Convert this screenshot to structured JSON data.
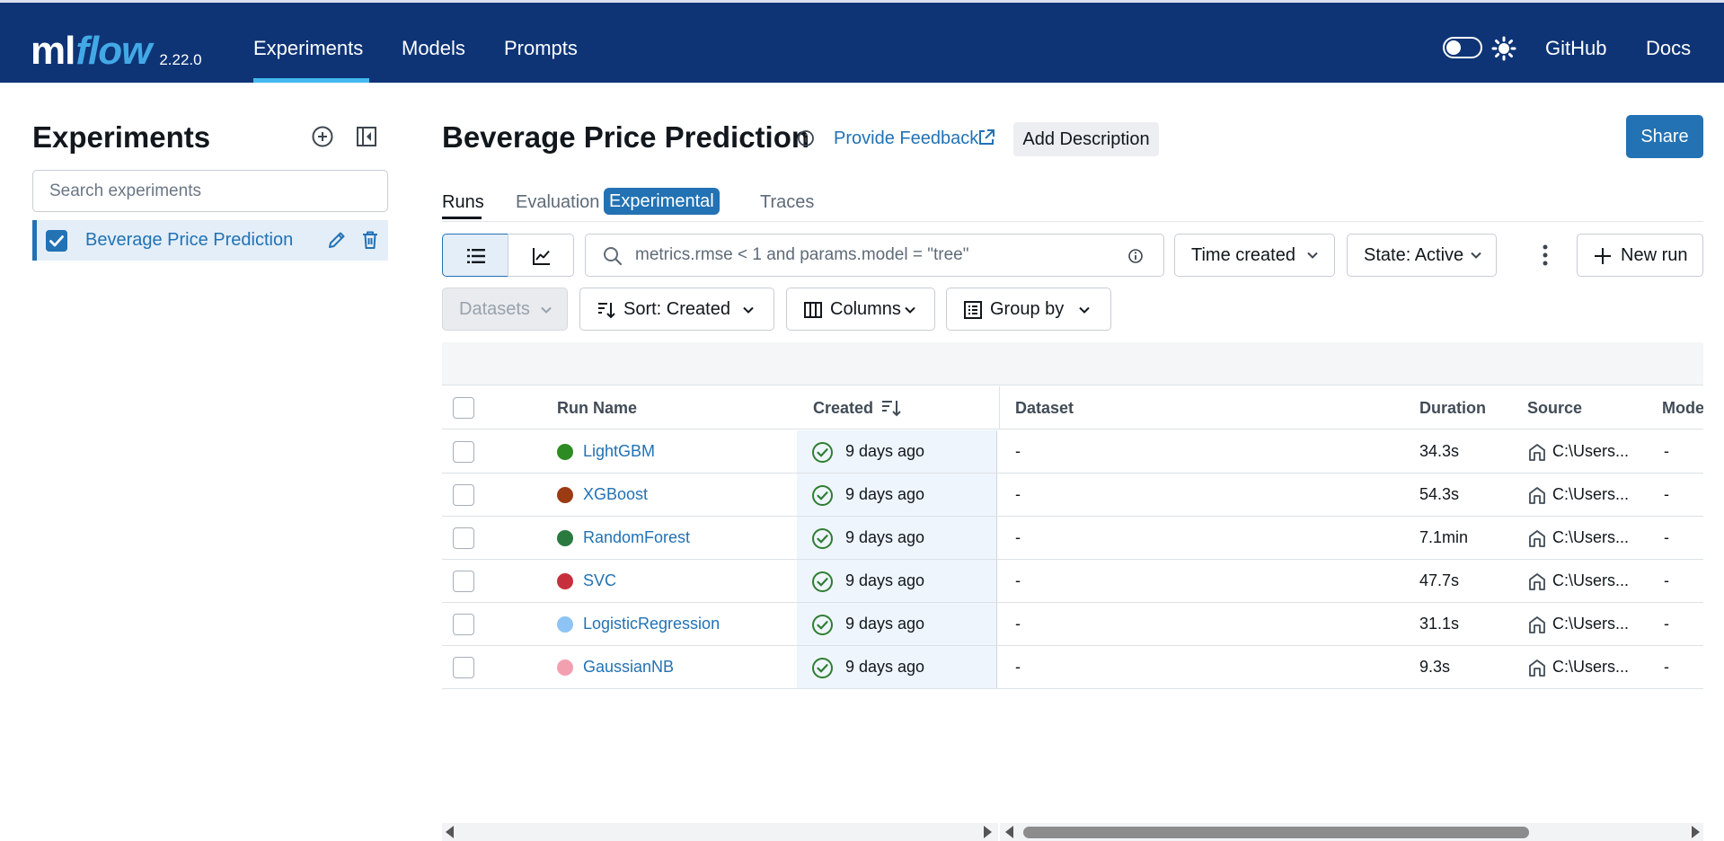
{
  "header": {
    "logo_ml": "ml",
    "logo_flow": "flow",
    "version": "2.22.0",
    "nav": [
      "Experiments",
      "Models",
      "Prompts"
    ],
    "active_nav": "Experiments",
    "right_links": [
      "GitHub",
      "Docs"
    ],
    "theme_toggle_on": false,
    "icons": [
      "toggle-switch",
      "sun-icon"
    ],
    "colors": {
      "bar": "#0e3476",
      "accent": "#43b9ef",
      "flow": "#43a8e6"
    }
  },
  "sidebar": {
    "title": "Experiments",
    "search_placeholder": "Search experiments",
    "icons": [
      "add-circle-icon",
      "collapse-sidebar-icon"
    ],
    "experiments": [
      {
        "label": "Beverage Price Prediction",
        "checked": true,
        "icons": [
          "pencil-icon",
          "trash-icon"
        ]
      }
    ]
  },
  "main": {
    "title": "Beverage Price Prediction",
    "feedback_link": "Provide Feedback",
    "add_description": "Add Description",
    "share": "Share",
    "tabs": [
      {
        "label": "Runs",
        "active": true
      },
      {
        "label": "Evaluation",
        "badge": "Experimental"
      },
      {
        "label": "Traces"
      }
    ],
    "toolbar": {
      "query_placeholder": "metrics.rmse < 1 and params.model = \"tree\"",
      "time_filter": "Time created",
      "state_filter": "State: Active",
      "new_run": "New run",
      "datasets": "Datasets",
      "sort": "Sort: Created",
      "columns": "Columns",
      "group_by": "Group by"
    },
    "table": {
      "headers": [
        "Run Name",
        "Created",
        "Dataset",
        "Duration",
        "Source",
        "Models"
      ],
      "rows": [
        {
          "name": "LightGBM",
          "color": "#2e8b23",
          "created": "9 days ago",
          "dataset": "-",
          "duration": "34.3s",
          "source": "C:\\Users...",
          "models": "-"
        },
        {
          "name": "XGBoost",
          "color": "#9a3b13",
          "created": "9 days ago",
          "dataset": "-",
          "duration": "54.3s",
          "source": "C:\\Users...",
          "models": "-"
        },
        {
          "name": "RandomForest",
          "color": "#2a7a3f",
          "created": "9 days ago",
          "dataset": "-",
          "duration": "7.1min",
          "source": "C:\\Users...",
          "models": "-"
        },
        {
          "name": "SVC",
          "color": "#c6303d",
          "created": "9 days ago",
          "dataset": "-",
          "duration": "47.7s",
          "source": "C:\\Users...",
          "models": "-"
        },
        {
          "name": "LogisticRegression",
          "color": "#8ec4f5",
          "created": "9 days ago",
          "dataset": "-",
          "duration": "31.1s",
          "source": "C:\\Users...",
          "models": "-"
        },
        {
          "name": "GaussianNB",
          "color": "#f2a0b0",
          "created": "9 days ago",
          "dataset": "-",
          "duration": "9.3s",
          "source": "C:\\Users...",
          "models": "-"
        }
      ]
    }
  }
}
